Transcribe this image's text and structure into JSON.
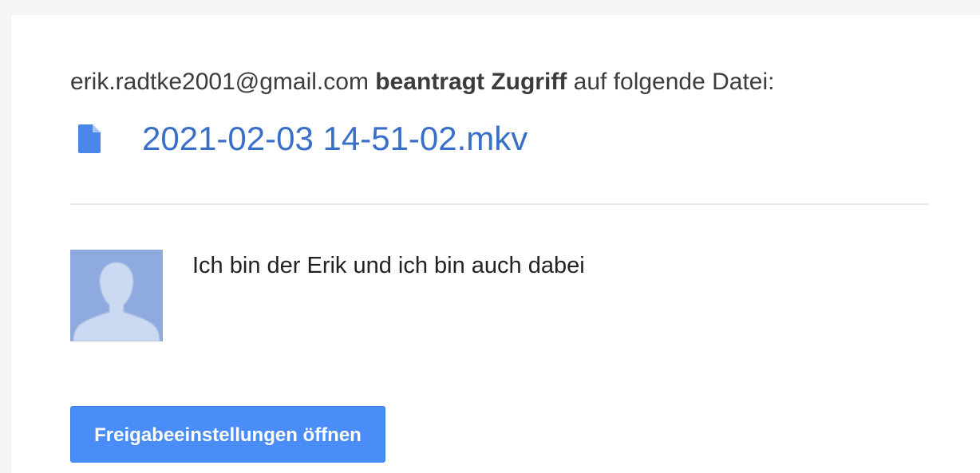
{
  "request": {
    "email": "erik.radtke2001@gmail.com",
    "action": "beantragt Zugriff",
    "suffix": "auf folgende Datei:"
  },
  "file": {
    "name": "2021-02-03 14-51-02.mkv",
    "icon": "document-icon",
    "link_color": "#3a6fc9"
  },
  "message": {
    "avatar_icon": "default-avatar-icon",
    "text": "Ich bin der Erik und ich bin auch dabei"
  },
  "actions": {
    "open_sharing_label": "Freigabeeinstellungen öffnen",
    "button_color": "#4b8df8"
  }
}
